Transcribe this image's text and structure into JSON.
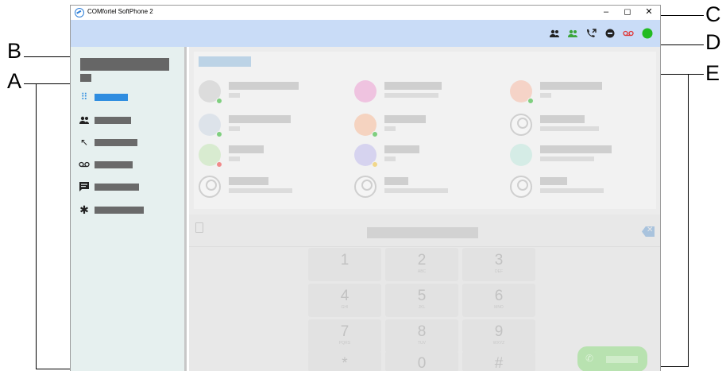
{
  "window": {
    "title": "COMfortel SoftPhone 2",
    "controls": {
      "minimize": "–",
      "maximize": "◻",
      "close": "✕"
    }
  },
  "callouts": [
    "A",
    "B",
    "C",
    "D",
    "E"
  ],
  "toolbar": {
    "icons": [
      "contacts-icon",
      "team-contacts-icon",
      "call-forward-icon",
      "do-not-disturb-icon",
      "voicemail-icon",
      "presence-available-icon"
    ],
    "colors": {
      "contacts": "#222222",
      "team": "#3aa53a",
      "dnd": "#222222",
      "voicemail": "#e03333",
      "presence": "#22bb22"
    }
  },
  "sidebar": {
    "nav": [
      {
        "icon": "dialpad-icon",
        "active": true
      },
      {
        "icon": "contacts-icon",
        "active": false
      },
      {
        "icon": "call-history-icon",
        "active": false
      },
      {
        "icon": "voicemail-icon",
        "active": false
      },
      {
        "icon": "chat-icon",
        "active": false
      },
      {
        "icon": "settings-gear-icon",
        "active": false
      }
    ]
  },
  "dialpad": {
    "keys": [
      {
        "digit": "1",
        "letters": ""
      },
      {
        "digit": "2",
        "letters": "ABC"
      },
      {
        "digit": "3",
        "letters": "DEF"
      },
      {
        "digit": "4",
        "letters": "GHI"
      },
      {
        "digit": "5",
        "letters": "JKL"
      },
      {
        "digit": "6",
        "letters": "MNO"
      },
      {
        "digit": "7",
        "letters": "PQRS"
      },
      {
        "digit": "8",
        "letters": "TUV"
      },
      {
        "digit": "9",
        "letters": "WXYZ"
      },
      {
        "digit": "*",
        "letters": ""
      },
      {
        "digit": "0",
        "letters": "+"
      },
      {
        "digit": "#",
        "letters": ""
      }
    ]
  },
  "accent": "#2f8de0"
}
